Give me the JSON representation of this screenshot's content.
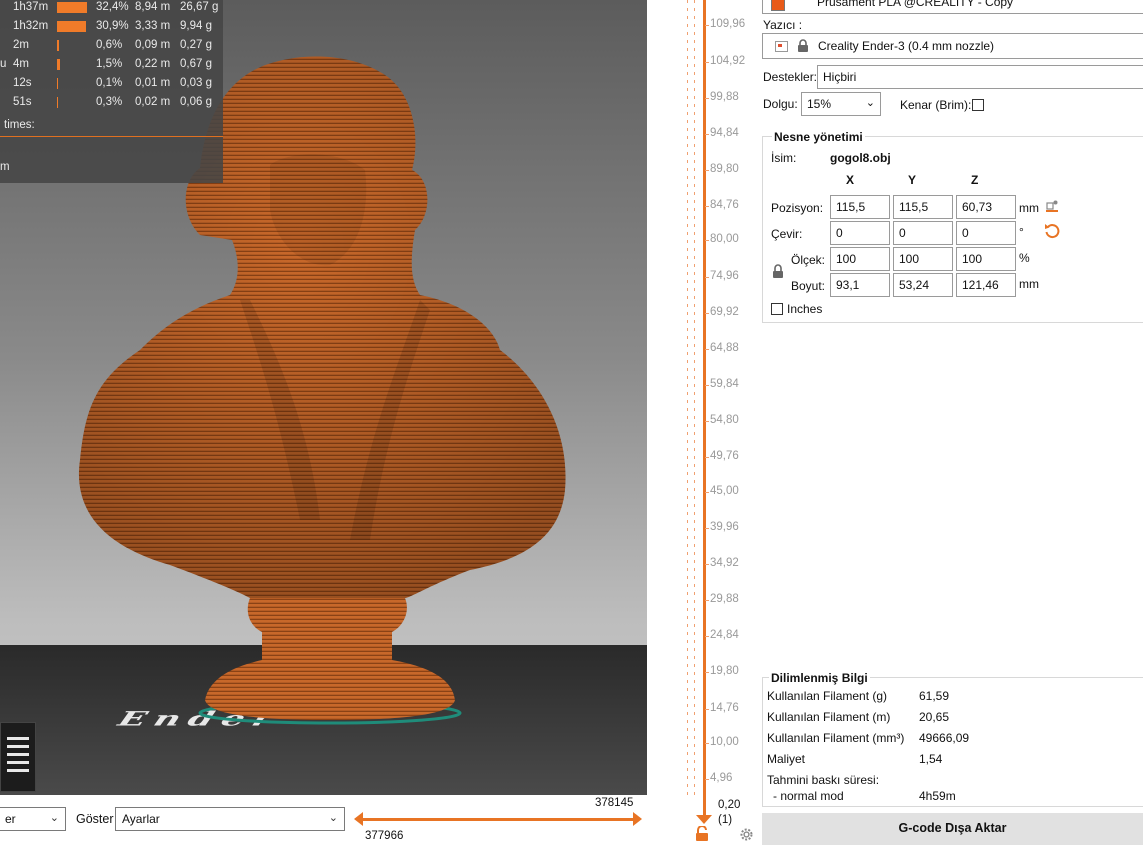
{
  "stats": {
    "rows": [
      {
        "label": "",
        "time": "1h37m",
        "percent": 32.4,
        "percent_text": "32,4%",
        "meters": "8,94 m",
        "grams": "26,67 g"
      },
      {
        "label": "",
        "time": "1h32m",
        "percent": 30.9,
        "percent_text": "30,9%",
        "meters": "3,33 m",
        "grams": "9,94 g"
      },
      {
        "label": "",
        "time": "2m",
        "percent": 0.6,
        "percent_text": "0,6%",
        "meters": "0,09 m",
        "grams": "0,27 g"
      },
      {
        "label": "u",
        "time": "4m",
        "percent": 1.5,
        "percent_text": "1,5%",
        "meters": "0,22 m",
        "grams": "0,67 g"
      },
      {
        "label": "",
        "time": "12s",
        "percent": 0.1,
        "percent_text": "0,1%",
        "meters": "0,01 m",
        "grams": "0,03 g"
      },
      {
        "label": "",
        "time": "51s",
        "percent": 0.3,
        "percent_text": "0,3%",
        "meters": "0,02 m",
        "grams": "0,06 g"
      }
    ],
    "times_label": "times:",
    "bottom_label": "m"
  },
  "viewport": {
    "bed_logo_text": "Ender",
    "model_color": "#c8682a"
  },
  "toolbar": {
    "view_select_value": "er",
    "show_label": "Göster",
    "show_select_value": "Ayarlar",
    "h_slider_right_value": "378145",
    "h_slider_left_value": "377966"
  },
  "layer_slider": {
    "ticks": [
      "109,96",
      "104,92",
      "99,88",
      "94,84",
      "89,80",
      "84,76",
      "80,00",
      "74,96",
      "69,92",
      "64,88",
      "59,84",
      "54,80",
      "49,76",
      "45,00",
      "39,96",
      "34,92",
      "29,88",
      "24,84",
      "19,80",
      "14,76",
      "10,00",
      "4,96"
    ],
    "bottom_value": "0,20",
    "bottom_sub": "(1)"
  },
  "panel": {
    "filament_value": "Prusament PLA @CREALITY - Copy",
    "printer_label": "Yazıcı :",
    "printer_value": "Creality Ender-3 (0.4 mm nozzle)",
    "supports_label": "Destekler:",
    "supports_value": "Hiçbiri",
    "infill_label": "Dolgu:",
    "infill_value": "15%",
    "brim_label": "Kenar (Brim):",
    "object_manipulation": {
      "title": "Nesne yönetimi",
      "name_label": "İsim:",
      "name_value": "gogol8.obj",
      "axis_x": "X",
      "axis_y": "Y",
      "axis_z": "Z",
      "position_label": "Pozisyon:",
      "position": [
        "115,5",
        "115,5",
        "60,73"
      ],
      "position_unit": "mm",
      "rotation_label": "Çevir:",
      "rotation": [
        "0",
        "0",
        "0"
      ],
      "rotation_unit": "°",
      "scale_label": "Ölçek:",
      "scale": [
        "100",
        "100",
        "100"
      ],
      "scale_unit": "%",
      "size_label": "Boyut:",
      "size": [
        "93,1",
        "53,24",
        "121,46"
      ],
      "size_unit": "mm",
      "inches_label": "Inches"
    },
    "sliced_info": {
      "title": "Dilimlenmiş Bilgi",
      "filament_g_label": "Kullanılan Filament (g)",
      "filament_g": "61,59",
      "filament_m_label": "Kullanılan Filament (m)",
      "filament_m": "20,65",
      "filament_mm3_label": "Kullanılan Filament (mm³)",
      "filament_mm3": "49666,09",
      "cost_label": "Maliyet",
      "cost": "1,54",
      "est_time_label": "Tahmini baskı süresi:",
      "normal_mode_label": "- normal mod",
      "normal_mode_time": "4h59m"
    },
    "export_button": "G-code Dışa Aktar"
  },
  "colors": {
    "accent": "#e87424",
    "stats_bar": "#f07b29",
    "model": "#c8682a"
  }
}
